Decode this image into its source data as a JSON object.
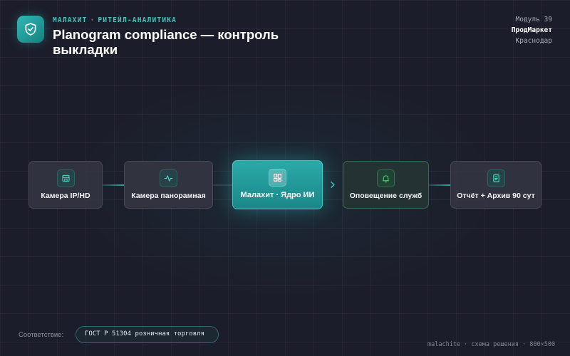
{
  "header": {
    "brand": "МАЛАХИТ",
    "separator": "·",
    "category": "РИТЕЙЛ-АНАЛИТИКА",
    "title": "Planogram compliance — контроль выкладки",
    "logo_icon": "shield-check-icon"
  },
  "meta": {
    "module": "Модуль 39",
    "client": "ПродМаркет",
    "city": "Краснодар"
  },
  "flow": {
    "nodes": [
      {
        "label": "Камера IP/HD",
        "icon": "store-icon"
      },
      {
        "label": "Камера панорамная",
        "icon": "activity-icon"
      },
      {
        "label": "Малахит · Ядро ИИ",
        "icon": "grid-icon"
      },
      {
        "label": "Оповещение служб",
        "icon": "bell-icon"
      },
      {
        "label": "Отчёт + Архив 90 сут",
        "icon": "document-icon"
      }
    ]
  },
  "footer": {
    "compliance_label": "Соответствие:",
    "compliance_value": "ГОСТ Р 51304 розничная торговля",
    "signature": "malachite · схема решения · 800×500"
  },
  "colors": {
    "background": "#1c1d2a",
    "accent": "#2ba9a9",
    "accent_text": "#46c4bd",
    "alert_green": "#4fbf7a"
  }
}
